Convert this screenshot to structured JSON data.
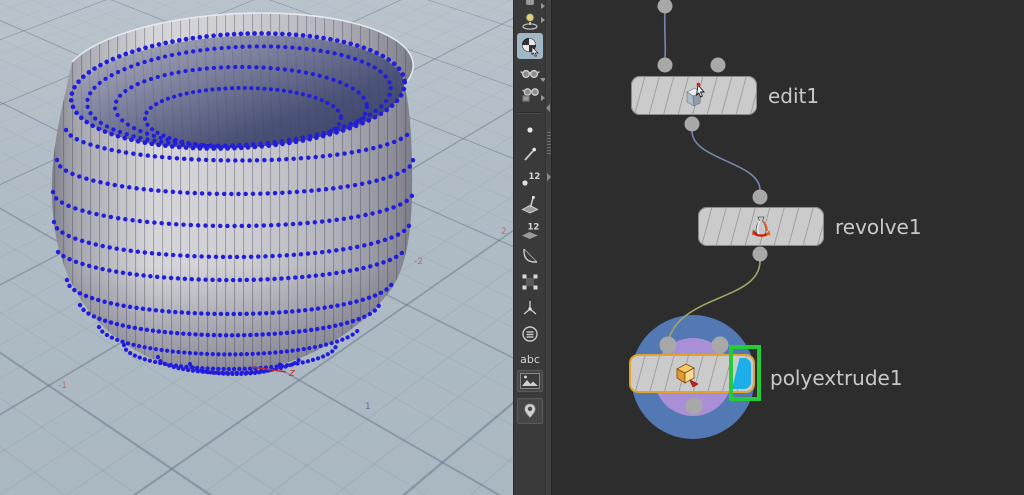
{
  "viewport": {
    "axis_label": "z",
    "grid_labels": {
      "left_neg1": "-1",
      "bottom_pos1": "1",
      "mid_neg2": "-2",
      "right_pos2": "2"
    },
    "colors": {
      "background": "#afbbc5",
      "grid_line": "#6b7a8c",
      "point_blue": "#221ddd",
      "surface_gray": "#cfcfd4",
      "axis_red": "#c03030"
    }
  },
  "toolbar": {
    "abc_label": "abc",
    "point_numbers_badge": "12",
    "prim_numbers_badge": "12",
    "buttons": [
      "secure-selection",
      "select",
      "view",
      "view-isolate",
      "display-points",
      "display-point-normals",
      "display-point-numbers",
      "display-prim-normals",
      "display-prim-numbers",
      "display-hulls",
      "display-handles",
      "display-normals",
      "display-poles",
      "display-labels",
      "background-image",
      "snap-location"
    ]
  },
  "network_editor": {
    "nodes": [
      {
        "name": "edit1",
        "type": "edit"
      },
      {
        "name": "revolve1",
        "type": "revolve"
      },
      {
        "name": "polyextrude1",
        "type": "polyextrude",
        "selected": true,
        "display_flag": true
      }
    ],
    "colors": {
      "background": "#2d2d2d",
      "node_body": "#cbcbcb",
      "selection_outline": "#e0a32e",
      "display_flag": "#1caee8",
      "highlight_box": "#25cc3a",
      "halo_outer": "#5379b5",
      "halo_inner": "#a98fd6",
      "wire": "#7488ad",
      "wire_alt": "#a3a464",
      "connector_dot": "#a8a8a8",
      "label_text": "#c9c9c9"
    }
  }
}
